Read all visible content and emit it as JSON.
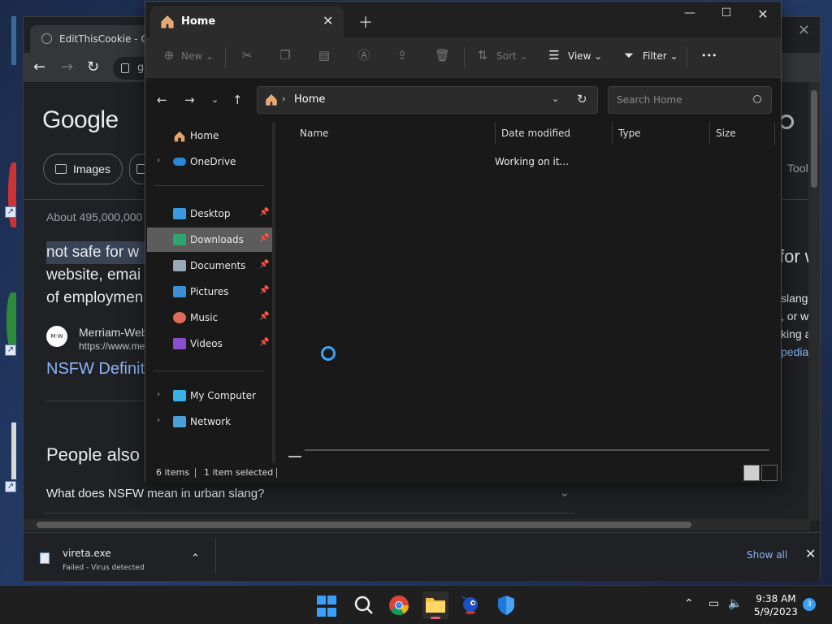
{
  "chrome": {
    "tab_title": "EditThisCookie - Chr",
    "omnibox_text": "g",
    "google_logo": "Google",
    "chips": [
      "Images"
    ],
    "tools_label": "Tools",
    "about_text": "About 495,000,000",
    "snippet_lines": [
      "not safe for w",
      "website, emai",
      "of employmen"
    ],
    "source_name": "Merriam-Web",
    "source_url": "https://www.me",
    "source_badge": "M·W",
    "result_link": "NSFW Definit",
    "people_also_ask": "People also a",
    "question": "What does NSFW mean in urban slang?",
    "right_fragments": [
      "for w",
      "slang c",
      ", or we",
      "king at",
      "pedia"
    ]
  },
  "download_bar": {
    "file_name": "vireta.exe",
    "status": "Failed - Virus detected",
    "show_all": "Show all"
  },
  "explorer": {
    "tab_label": "Home",
    "commands": {
      "new": "New",
      "sort": "Sort",
      "view": "View",
      "filter": "Filter",
      "more": "•••"
    },
    "address": "Home",
    "search_placeholder": "Search Home",
    "sidebar": {
      "home": "Home",
      "onedrive": "OneDrive",
      "desktop": "Desktop",
      "downloads": "Downloads",
      "documents": "Documents",
      "pictures": "Pictures",
      "music": "Music",
      "videos": "Videos",
      "my_computer": "My Computer",
      "network": "Network"
    },
    "columns": [
      "Name",
      "Date modified",
      "Type",
      "Size"
    ],
    "loading_text": "Working on it...",
    "status": {
      "items": "6 items",
      "selected": "1 item selected"
    }
  },
  "taskbar": {
    "time": "9:38 AM",
    "date": "5/9/2023",
    "notification_count": "3"
  },
  "colors": {
    "accent": "#3da4f5",
    "explorer_bg": "#191919",
    "chrome_bg": "#202124",
    "link": "#8ab4f8"
  }
}
